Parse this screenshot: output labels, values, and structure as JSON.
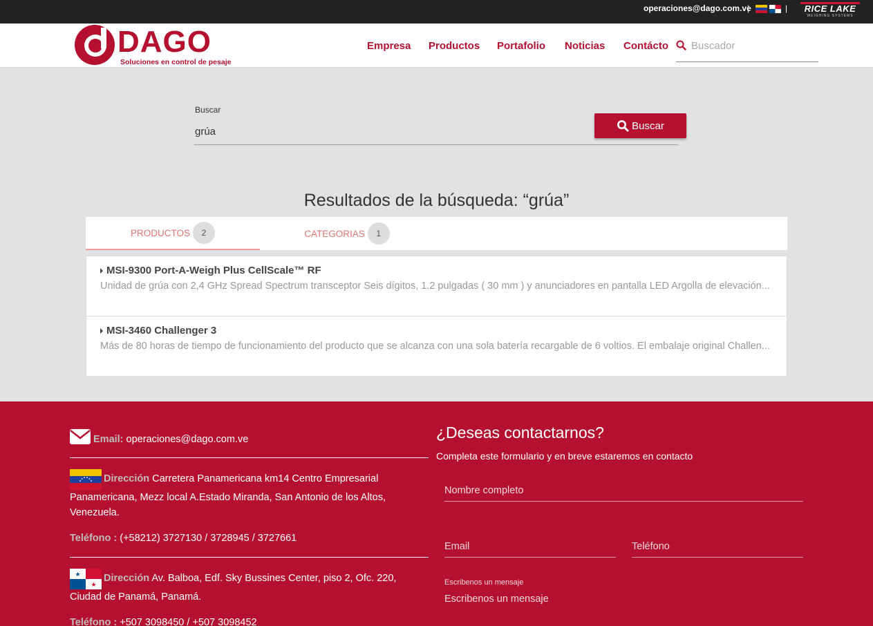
{
  "topbar": {
    "email": "operaciones@dago.com.ve",
    "sep": "|",
    "partner_name": "RICE LAKE",
    "partner_sub": "WEIGHING SYSTEMS"
  },
  "brand": {
    "name": "DAGO",
    "tagline": "Soluciones en control de pesaje",
    "color": "#b5102f"
  },
  "nav": {
    "items": [
      "Empresa",
      "Productos",
      "Portafolio",
      "Noticias",
      "Contácto"
    ],
    "search_placeholder": "Buscador"
  },
  "search": {
    "label": "Buscar",
    "value": "grúa",
    "button": "Buscar"
  },
  "results": {
    "title": "Resultados de la búsqueda: “grúa”",
    "tabs": [
      {
        "label": "PRODUCTOS",
        "count": "2"
      },
      {
        "label": "CATEGORIAS",
        "count": "1"
      }
    ],
    "items": [
      {
        "title": "MSI-9300 Port-A-Weigh Plus CellScale™ RF",
        "desc": "Unidad de grúa con 2,4 GHz Spread Spectrum transceptor Seis dígitos, 1.2 pulgadas ( 30 mm ) y anunciadores en pantalla LED Argolla de elevación..."
      },
      {
        "title": "MSI-3460 Challenger 3",
        "desc": "Más de 80 horas de tiempo de funcionamiento del producto que se alcanza con una sola batería recargable de 6 voltios. El embalaje original Challen..."
      }
    ]
  },
  "footer": {
    "email_label": "Email:",
    "email": "operaciones@dago.com.ve",
    "ve": {
      "dir_label": "Dirección",
      "dir_first": "Carretera Panamericana km14 Centro Empresarial",
      "dir_rest": "Panamericana, Mezz local A.Estado Miranda, San Antonio de los Altos, Venezuela.",
      "tel_label": "Teléfono :",
      "tel": "(+58212) 3727130 / 3728945 / 3727661"
    },
    "pa": {
      "dir_label": "Dirección",
      "dir_first": "Av. Balboa, Edf. Sky Bussines Center, piso 2, Ofc. 220,",
      "dir_rest": "Ciudad de Panamá, Panamá.",
      "tel_label": "Teléfono :",
      "tel": "+507 3098450 / +507 3098452"
    },
    "contact": {
      "title": "¿Deseas contactarnos?",
      "subtitle": "Completa este formulario y en breve estaremos en contacto",
      "name_placeholder": "Nombre completo",
      "email_placeholder": "Email",
      "phone_placeholder": "Teléfono",
      "message_label": "Escribenos un mensaje",
      "message_placeholder": "Escribenos un mensaje"
    }
  }
}
